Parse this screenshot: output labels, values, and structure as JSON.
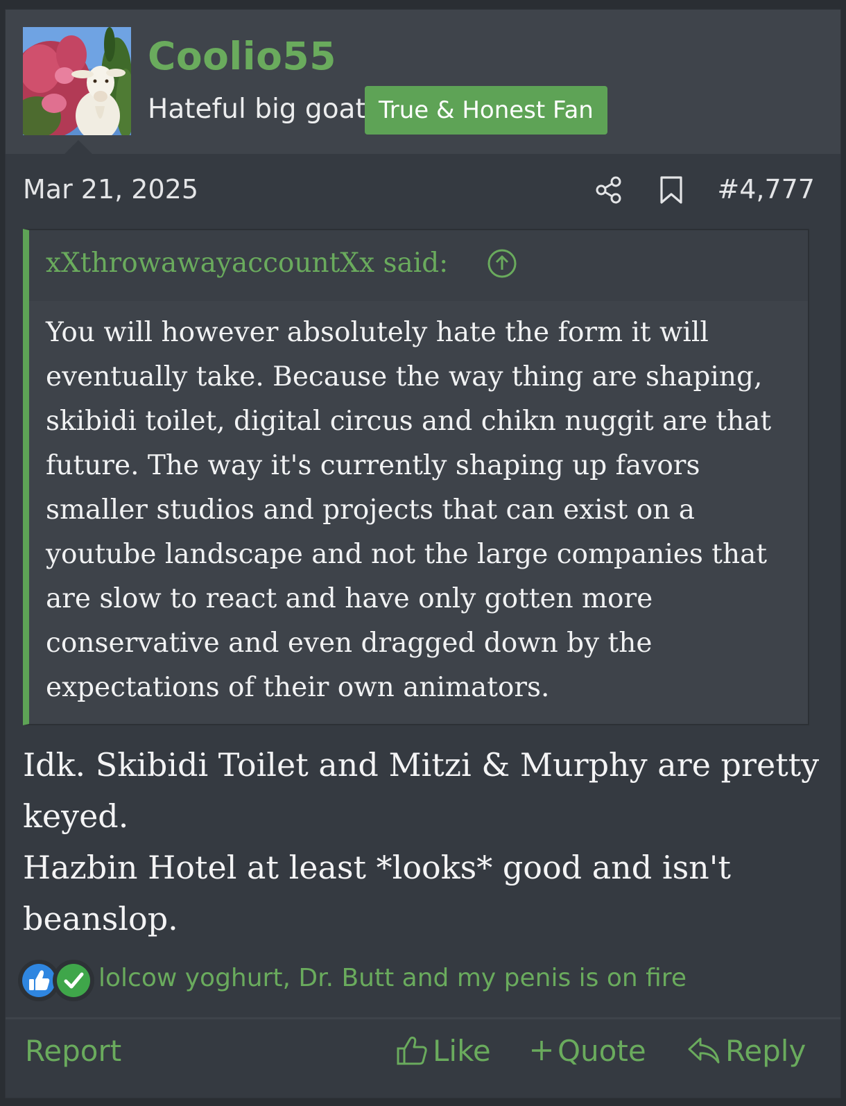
{
  "post": {
    "username": "Coolio55",
    "user_title": "Hateful big goat",
    "user_banner": "True & Honest Fan",
    "date": "Mar 21, 2025",
    "post_number": "#4,777",
    "icons": {
      "share": "share-icon",
      "bookmark": "bookmark-icon",
      "quote_jump": "arrow-up-circle-icon"
    }
  },
  "quote": {
    "author": "xXthrowawayaccountXx said:",
    "lines": [
      "You will however absolutely hate the form it will",
      "eventually take. Because the way thing are shaping,",
      "skibidi toilet, digital circus and chikn nuggit are that",
      "future. The way it's currently shaping up favors",
      "smaller studios and projects that can exist on a",
      "youtube landscape and not the large companies that",
      "are slow to react and have only gotten more",
      "conservative and even dragged down by the",
      "expectations of their own animators."
    ]
  },
  "reply": {
    "lines": [
      "Idk. Skibidi Toilet and Mitzi & Murphy are pretty",
      "keyed.",
      "Hazbin Hotel at least *looks* good and isn't",
      "beanslop."
    ]
  },
  "reactions": {
    "users": "lolcow yoghurt, Dr. Butt and my penis is on fire",
    "icons": [
      "thumbs-up-reaction-icon",
      "agree-check-reaction-icon"
    ]
  },
  "actions": {
    "report": "Report",
    "like": "Like",
    "quote": "Quote",
    "reply": "Reply"
  },
  "colors": {
    "accent_green": "#6aab5d",
    "banner_green": "#5ea356",
    "background": "#353a41",
    "header_background": "#3f444b",
    "like_blue": "#2f86e0",
    "agree_green": "#3fa64a"
  }
}
